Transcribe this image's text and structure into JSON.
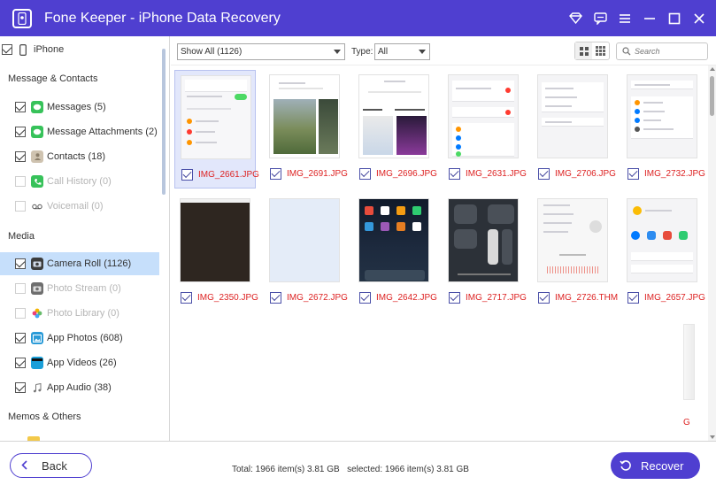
{
  "window": {
    "title": "Fone Keeper - iPhone Data Recovery",
    "icons": [
      "diamond-icon",
      "chat-icon",
      "menu-icon",
      "minimize-icon",
      "maximize-icon",
      "close-icon"
    ]
  },
  "sidebar": {
    "device": "iPhone",
    "sections": [
      {
        "title": "Message & Contacts",
        "items": [
          {
            "label": "Messages",
            "count": "(5)",
            "checked": true,
            "enabled": true,
            "icon": "messages-icon",
            "color": "#37c25a"
          },
          {
            "label": "Message Attachments",
            "count": "(2)",
            "checked": true,
            "enabled": true,
            "icon": "attachments-icon",
            "color": "#37c25a"
          },
          {
            "label": "Contacts",
            "count": "(18)",
            "checked": true,
            "enabled": true,
            "icon": "contacts-icon",
            "color": "#b9a58a"
          },
          {
            "label": "Call History",
            "count": "(0)",
            "checked": false,
            "enabled": false,
            "icon": "phone-icon",
            "color": "#37c25a"
          },
          {
            "label": "Voicemail",
            "count": "(0)",
            "checked": false,
            "enabled": false,
            "icon": "voicemail-icon",
            "color": "#ffffff"
          }
        ]
      },
      {
        "title": "Media",
        "items": [
          {
            "label": "Camera Roll",
            "count": "(1126)",
            "checked": true,
            "enabled": true,
            "selected": true,
            "icon": "camera-icon",
            "color": "#3c3c3c"
          },
          {
            "label": "Photo Stream",
            "count": "(0)",
            "checked": false,
            "enabled": false,
            "icon": "photo-stream-icon",
            "color": "#6e6e6e"
          },
          {
            "label": "Photo Library",
            "count": "(0)",
            "checked": false,
            "enabled": false,
            "icon": "photo-library-icon",
            "color": "#f0a030"
          },
          {
            "label": "App Photos",
            "count": "(608)",
            "checked": true,
            "enabled": true,
            "icon": "app-photos-icon",
            "color": "#2a9bd8"
          },
          {
            "label": "App Videos",
            "count": "(26)",
            "checked": true,
            "enabled": true,
            "icon": "app-videos-icon",
            "color": "#1a9fd9"
          },
          {
            "label": "App Audio",
            "count": "(38)",
            "checked": true,
            "enabled": true,
            "icon": "app-audio-icon",
            "color": "#ffffff"
          }
        ]
      },
      {
        "title": "Memos & Others",
        "items": []
      }
    ]
  },
  "toolbar": {
    "filter_value": "Show All (1126)",
    "type_label": "Type:",
    "type_value": "All",
    "search_placeholder": "Search"
  },
  "files": [
    {
      "name": "IMG_2661.JPG",
      "selected": true,
      "checked": true,
      "thumb": "settings"
    },
    {
      "name": "IMG_2691.JPG",
      "selected": false,
      "checked": true,
      "thumb": "appstore"
    },
    {
      "name": "IMG_2696.JPG",
      "selected": false,
      "checked": true,
      "thumb": "products"
    },
    {
      "name": "IMG_2631.JPG",
      "selected": false,
      "checked": true,
      "thumb": "settings2"
    },
    {
      "name": "IMG_2706.JPG",
      "selected": false,
      "checked": true,
      "thumb": "list"
    },
    {
      "name": "IMG_2732.JPG",
      "selected": false,
      "checked": true,
      "thumb": "storage"
    },
    {
      "name": "IMG_2350.JPG",
      "selected": false,
      "checked": true,
      "thumb": "dark"
    },
    {
      "name": "IMG_2672.JPG",
      "selected": false,
      "checked": true,
      "thumb": "blank"
    },
    {
      "name": "IMG_2642.JPG",
      "selected": false,
      "checked": true,
      "thumb": "homescreen"
    },
    {
      "name": "IMG_2717.JPG",
      "selected": false,
      "checked": true,
      "thumb": "control"
    },
    {
      "name": "IMG_2726.THM",
      "selected": false,
      "checked": true,
      "thumb": "recordings"
    },
    {
      "name": "IMG_2657.JPG",
      "selected": false,
      "checked": true,
      "thumb": "share"
    }
  ],
  "partial_tile_letter": "G",
  "footer": {
    "back_label": "Back",
    "total_label": "Total: 1966 item(s) 3.81 GB",
    "selected_label": "selected: 1966 item(s) 3.81 GB",
    "recover_label": "Recover"
  },
  "colors": {
    "accent": "#4f3fd0",
    "selected_row": "#c6dffb",
    "file_name": "#dd2222"
  }
}
